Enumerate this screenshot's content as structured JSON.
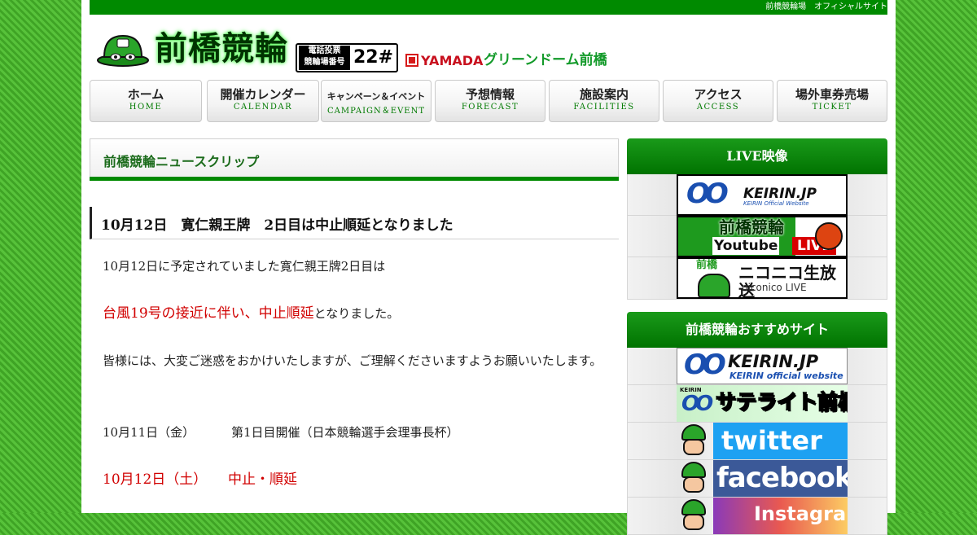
{
  "topbar": {
    "text": "前橋競輪場　オフィシャルサイト"
  },
  "header": {
    "logo": "前橋競輪",
    "tel_label_1": "電話投票",
    "tel_label_2": "競輪場番号",
    "tel_number": "22#",
    "yamada_brand": "YAMADA",
    "dome_name": "グリーンドーム前橋"
  },
  "nav": [
    {
      "label": "ホーム",
      "sub": "HOME"
    },
    {
      "label": "開催カレンダー",
      "sub": "CALENDAR"
    },
    {
      "label": "キャンペーン＆イベント",
      "sub": "CAMPAIGN＆EVENT"
    },
    {
      "label": "予想情報",
      "sub": "FORECAST"
    },
    {
      "label": "施設案内",
      "sub": "FACILITIES"
    },
    {
      "label": "アクセス",
      "sub": "ACCESS"
    },
    {
      "label": "場外車券売場",
      "sub": "TICKET"
    }
  ],
  "main": {
    "section_title": "前橋競輪ニュースクリップ",
    "article_title": "10月12日　寛仁親王牌　2日目は中止順延となりました",
    "p1": "10月12日に予定されていました寛仁親王牌2日目は",
    "p2_red": "台風19号の接近に伴い、中止順延",
    "p2_rest": "となりました。",
    "p3": "皆様には、大変ご迷惑をおかけいたしますが、ご理解くださいますようお願いいたします。",
    "p4_date": "10月11日（金）",
    "p4_text": "第1日目開催（日本競輪選手会理事長杯）",
    "p5_date": "10月12日（土）",
    "p5_text": "中止・順延"
  },
  "sidebar": {
    "live_title": "LIVE映像",
    "live_banners": {
      "keirin_oo": "OO",
      "keirin_name": "KEIRIN.JP",
      "keirin_sub": "KEIRIN Official Website",
      "yt_title": "前橋競輪",
      "yt_word": "Youtube",
      "yt_live": "LIVE",
      "nico_maebashi": "前橋",
      "nico_title": "ニコニコ生放送",
      "nico_sub": "niconico LIVE"
    },
    "rec_title": "前橋競輪おすすめサイト",
    "rec_banners": {
      "keirin_oo": "OO",
      "keirin_name": "KEIRIN.JP",
      "keirin_sub": "KEIRIN official website",
      "sat_keirin": "KEIRIN",
      "sat_oo": "OO",
      "sat_title": "サテライト前橋",
      "twitter": "twitter",
      "facebook": "facebook",
      "instagram": "Instagram"
    }
  },
  "colors": {
    "brand_green": "#008a00",
    "alert_red": "#d10000",
    "twitter_blue": "#1da1f2",
    "facebook_blue": "#3b5998"
  },
  "icons": [
    "mascot-helmet-icon",
    "yamada-mark-icon",
    "twitter-bird-icon",
    "facebook-icon",
    "instagram-icon"
  ]
}
